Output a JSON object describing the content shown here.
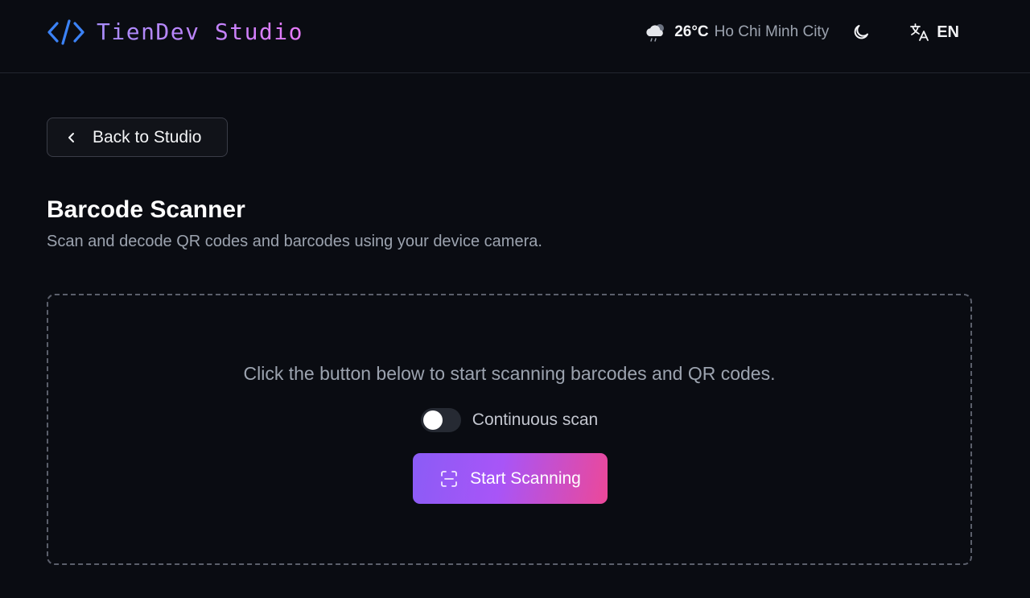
{
  "header": {
    "brand": "TienDev Studio",
    "weather": {
      "icon": "cloud-rain-icon",
      "temperature": "26°C",
      "city": "Ho Chi Minh City"
    },
    "theme_icon": "moon-icon",
    "language": {
      "icon": "translate-icon",
      "label": "EN"
    }
  },
  "nav": {
    "back_label": "Back to Studio"
  },
  "page": {
    "title": "Barcode Scanner",
    "subtitle": "Scan and decode QR codes and barcodes using your device camera."
  },
  "scanner": {
    "instruction": "Click the button below to start scanning barcodes and QR codes.",
    "continuous_label": "Continuous scan",
    "continuous_enabled": false,
    "start_label": "Start Scanning",
    "start_icon": "scan-icon"
  },
  "colors": {
    "background": "#0a0c12",
    "brand_gradient_start": "#a78bfa",
    "brand_gradient_end": "#e879f9",
    "button_gradient_start": "#8b5cf6",
    "button_gradient_end": "#ec4899",
    "logo_icon": "#3b82f6"
  }
}
